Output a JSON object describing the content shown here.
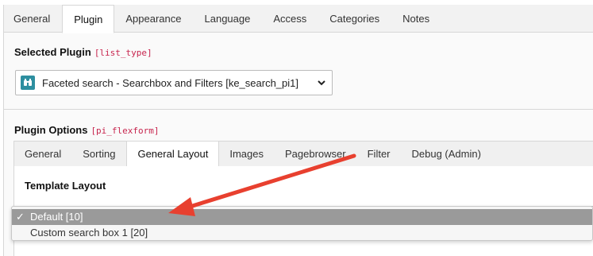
{
  "top_tabs": [
    "General",
    "Plugin",
    "Appearance",
    "Language",
    "Access",
    "Categories",
    "Notes"
  ],
  "active_top_tab": "Plugin",
  "selected_plugin": {
    "heading": "Selected Plugin",
    "field_code": "[list_type]",
    "value": "Faceted search - Searchbox and Filters [ke_search_pi1]",
    "icon": "binoculars-icon"
  },
  "plugin_options": {
    "heading": "Plugin Options",
    "field_code": "[pi_flexform]",
    "tabs": [
      "General",
      "Sorting",
      "General Layout",
      "Images",
      "Pagebrowser",
      "Filter",
      "Debug (Admin)"
    ],
    "active_tab": "General Layout"
  },
  "template_layout": {
    "label": "Template Layout",
    "options": [
      {
        "label": "Default [10]",
        "selected": true
      },
      {
        "label": "Custom search box 1 [20]",
        "selected": false
      }
    ],
    "check_mark": "✓"
  },
  "colors": {
    "annotation_arrow": "#e8402f",
    "plugin_icon": "#2e8fa0",
    "selected_option": "#9a9a9a"
  }
}
